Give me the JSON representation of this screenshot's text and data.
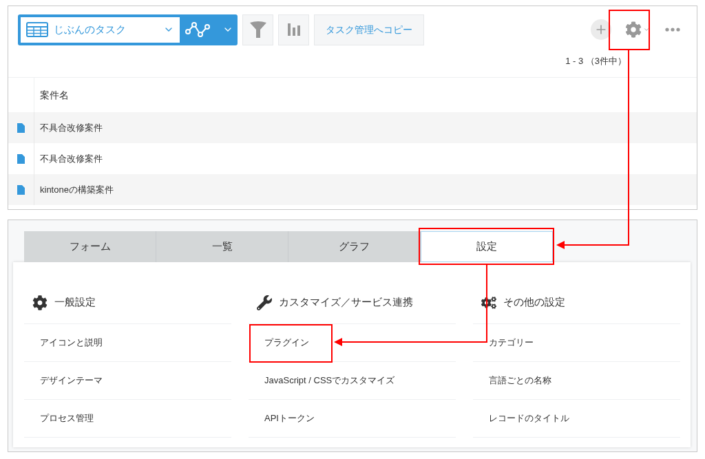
{
  "toolbar": {
    "view_name": "じぶんのタスク",
    "copy_button": "タスク管理へコピー"
  },
  "pagination": "1 - 3 （3件中）",
  "table": {
    "columns": [
      "案件名"
    ],
    "rows": [
      {
        "cells": [
          "不具合改修案件"
        ]
      },
      {
        "cells": [
          "不具合改修案件"
        ]
      },
      {
        "cells": [
          "kintoneの構築案件"
        ]
      }
    ]
  },
  "settings": {
    "tabs": [
      {
        "label": "フォーム",
        "selected": false
      },
      {
        "label": "一覧",
        "selected": false
      },
      {
        "label": "グラフ",
        "selected": false
      },
      {
        "label": "設定",
        "selected": true
      }
    ],
    "sections": [
      {
        "kind": "general",
        "title": "一般設定",
        "items": [
          "アイコンと説明",
          "デザインテーマ",
          "プロセス管理"
        ]
      },
      {
        "kind": "customize",
        "title": "カスタマイズ／サービス連携",
        "items": [
          "プラグイン",
          "JavaScript / CSSでカスタマイズ",
          "APIトークン"
        ]
      },
      {
        "kind": "other",
        "title": "その他の設定",
        "items": [
          "カテゴリー",
          "言語ごとの名称",
          "レコードのタイトル"
        ]
      }
    ]
  }
}
